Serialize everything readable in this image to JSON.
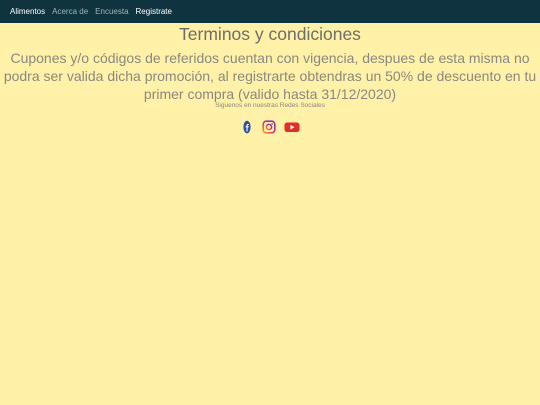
{
  "nav": {
    "items": [
      {
        "label": "Alimentos",
        "active": true
      },
      {
        "label": "Acerca de",
        "active": false
      },
      {
        "label": "Encuesta",
        "active": false
      },
      {
        "label": "Registrate",
        "active": true
      }
    ]
  },
  "main": {
    "title": "Terminos y condiciones",
    "body": "Cupones y/o códigos de referidos cuentan con vigencia, despues de esta misma no podra ser valida dicha promoción, al registrarte obtendras un 50% de descuento en tu primer compra (valido hasta 31/12/2020)",
    "social_label": "Siguenos en nuestras Redes Sociales"
  },
  "social": {
    "icons": [
      "facebook-icon",
      "instagram-icon",
      "youtube-icon"
    ]
  },
  "colors": {
    "background": "#fff1a8",
    "navbar": "#0f3440",
    "text": "#8a8880"
  }
}
